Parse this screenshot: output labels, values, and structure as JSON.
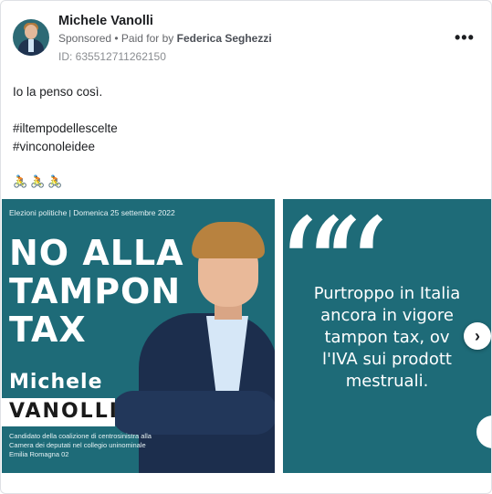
{
  "advertiser": {
    "name": "Michele Vanolli",
    "sponsored_label": "Sponsored",
    "paid_for_by_prefix": "• Paid for by",
    "paid_for_by": "Federica Seghezzi",
    "ad_id": "ID: 635512711262150",
    "more_icon": "more-horizontal-icon"
  },
  "post": {
    "line1": "Io la penso così.",
    "hashtag1": "#iltempodellescelte",
    "hashtag2": "#vinconoleidee",
    "emoji": "🚴🚴🚴"
  },
  "carousel": {
    "slide1": {
      "top_line": "Elezioni politiche | Domenica 25 settembre 2022",
      "headline_1": "NO ALLA",
      "headline_2": "TAMPON",
      "headline_3": "TAX",
      "first_name": "Michele",
      "last_name": "VANOLLI",
      "sub_1": "Candidato della coalizione di centrosinistra alla",
      "sub_2": "Camera dei deputati nel collegio uninominale",
      "sub_3": "Emilia Romagna 02"
    },
    "slide2": {
      "quote_mark": "“",
      "line1": "Purtroppo in Italia",
      "line2": "ancora in vigore",
      "line3": "tampon tax, ov",
      "line4": "l'IVA sui prodott",
      "line5": "mestruali."
    },
    "next_icon": "chevron-right-icon",
    "next_glyph": "›",
    "accent_color": "#1e6b78"
  }
}
